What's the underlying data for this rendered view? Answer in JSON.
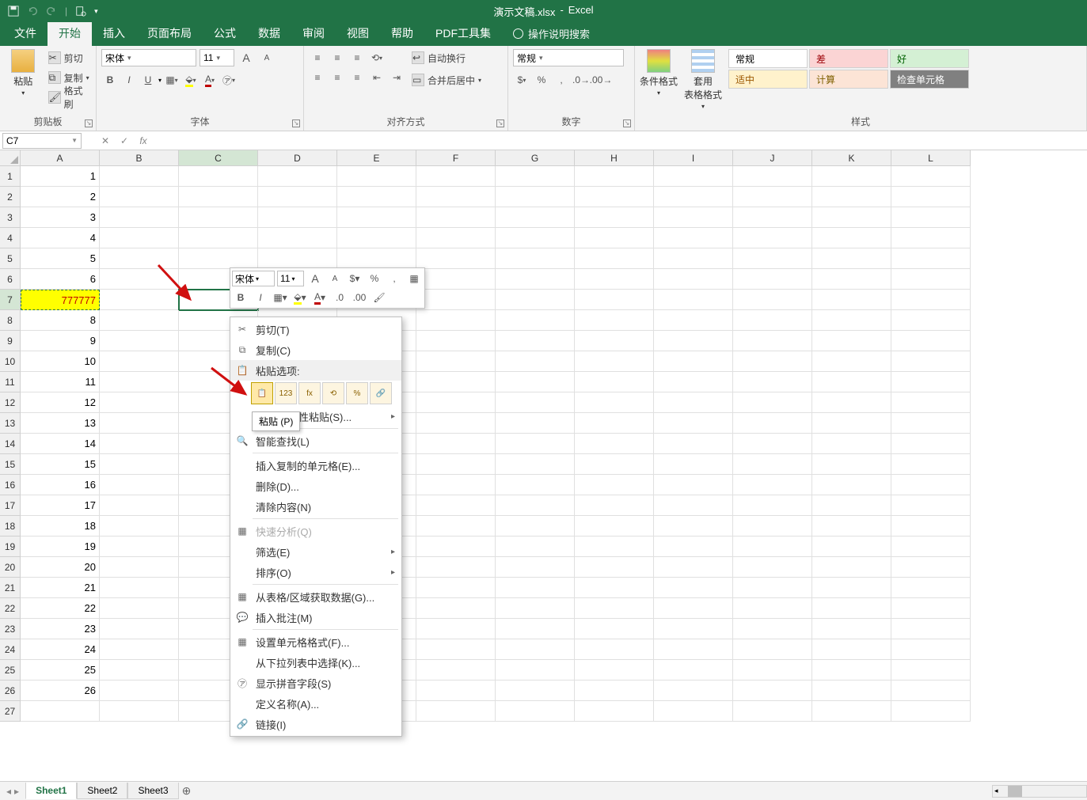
{
  "title": {
    "filename": "演示文稿.xlsx",
    "sep": "-",
    "app": "Excel"
  },
  "tabs": {
    "file": "文件",
    "home": "开始",
    "insert": "插入",
    "layout": "页面布局",
    "formulas": "公式",
    "data": "数据",
    "review": "审阅",
    "view": "视图",
    "help": "帮助",
    "pdf": "PDF工具集",
    "tell_me": "操作说明搜索"
  },
  "ribbon": {
    "clipboard": {
      "paste": "粘贴",
      "cut": "剪切",
      "copy": "复制",
      "painter": "格式刷",
      "label": "剪贴板"
    },
    "font": {
      "name": "宋体",
      "size": "11",
      "label": "字体",
      "bold": "B",
      "italic": "I",
      "underline": "U"
    },
    "alignment": {
      "wrap": "自动换行",
      "merge": "合并后居中",
      "label": "对齐方式"
    },
    "number": {
      "format": "常规",
      "label": "数字"
    },
    "styles": {
      "cond": "条件格式",
      "table": "套用\n表格格式",
      "normal": "常规",
      "bad": "差",
      "good": "好",
      "mid": "适中",
      "calc": "计算",
      "check": "检查单元格",
      "label": "样式"
    }
  },
  "formula_bar": {
    "name_box": "C7",
    "fx": "fx"
  },
  "columns": [
    "A",
    "B",
    "C",
    "D",
    "E",
    "F",
    "G",
    "H",
    "I",
    "J",
    "K",
    "L"
  ],
  "rows": [
    "1",
    "2",
    "3",
    "4",
    "5",
    "6",
    "7",
    "8",
    "9",
    "10",
    "11",
    "12",
    "13",
    "14",
    "15",
    "16",
    "17",
    "18",
    "19",
    "20",
    "21",
    "22",
    "23",
    "24",
    "25",
    "26",
    "27"
  ],
  "cells": {
    "A": [
      "1",
      "2",
      "3",
      "4",
      "5",
      "6",
      "777777",
      "8",
      "9",
      "10",
      "11",
      "12",
      "13",
      "14",
      "15",
      "16",
      "17",
      "18",
      "19",
      "20",
      "21",
      "22",
      "23",
      "24",
      "25",
      "26",
      ""
    ]
  },
  "mini_toolbar": {
    "font": "宋体",
    "size": "11",
    "a_big": "A",
    "a_small": "A",
    "percent": "%",
    "comma": ",",
    "bold": "B",
    "italic": "I"
  },
  "context_menu": {
    "cut": "剪切(T)",
    "copy": "复制(C)",
    "paste_options": "粘贴选项:",
    "paste_sub_123": "123",
    "paste_special": "选择性粘贴(S)...",
    "smart_lookup": "智能查找(L)",
    "insert": "插入复制的单元格(E)...",
    "delete": "删除(D)...",
    "clear": "清除内容(N)",
    "quick_analysis": "快速分析(Q)",
    "filter": "筛选(E)",
    "sort": "排序(O)",
    "get_data": "从表格/区域获取数据(G)...",
    "comment": "插入批注(M)",
    "format_cells": "设置单元格格式(F)...",
    "dropdown": "从下拉列表中选择(K)...",
    "phonetic": "显示拼音字段(S)",
    "define_name": "定义名称(A)...",
    "link": "链接(I)"
  },
  "tooltip": {
    "paste": "粘贴 (P)"
  },
  "sheets": {
    "s1": "Sheet1",
    "s2": "Sheet2",
    "s3": "Sheet3"
  }
}
